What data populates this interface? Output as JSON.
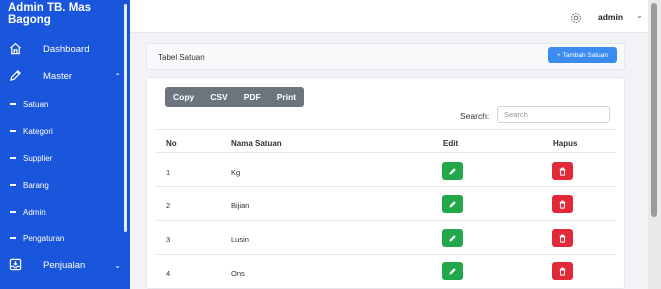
{
  "sidebar": {
    "brand": "Admin TB. Mas Bagong",
    "items": [
      {
        "label": "Dashboard",
        "icon": "home-icon"
      },
      {
        "label": "Master",
        "icon": "pencil-icon"
      },
      {
        "label": "Penjualan",
        "icon": "inbox-icon"
      }
    ],
    "master_sub": [
      "Satuan",
      "Kategori",
      "Supplier",
      "Barang",
      "Admin",
      "Pengaturan"
    ]
  },
  "topbar": {
    "user": "admin",
    "accent": "#1a56db"
  },
  "header": {
    "title": "Tabel Satuan",
    "add_button": "+ Tambah Satuan"
  },
  "table": {
    "export_buttons": [
      "Copy",
      "CSV",
      "PDF",
      "Print"
    ],
    "search_label": "Search:",
    "search_placeholder": "Search",
    "columns": [
      "No",
      "Nama Satuan",
      "Edit",
      "Hapus"
    ],
    "rows": [
      {
        "no": "1",
        "nama": "Kg"
      },
      {
        "no": "2",
        "nama": "Bijian"
      },
      {
        "no": "3",
        "nama": "Lusin"
      },
      {
        "no": "4",
        "nama": "Ons"
      }
    ]
  }
}
